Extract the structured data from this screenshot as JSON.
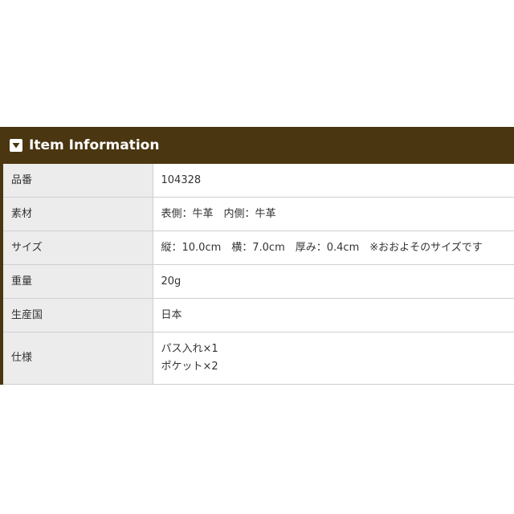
{
  "header": {
    "title": "Item Information",
    "icon": "triangle-down-icon",
    "bg_color": "#4a3610"
  },
  "rows": [
    {
      "label": "品番",
      "value": "104328"
    },
    {
      "label": "素材",
      "value": "表側：牛革　内側：牛革"
    },
    {
      "label": "サイズ",
      "value": "縦：10.0cm　横：7.0cm　厚み：0.4cm　※おおよそのサイズです"
    },
    {
      "label": "重量",
      "value": "20g"
    },
    {
      "label": "生産国",
      "value": "日本"
    },
    {
      "label": "仕様",
      "lines": [
        "パス入れ×1",
        "ポケット×2"
      ]
    }
  ]
}
